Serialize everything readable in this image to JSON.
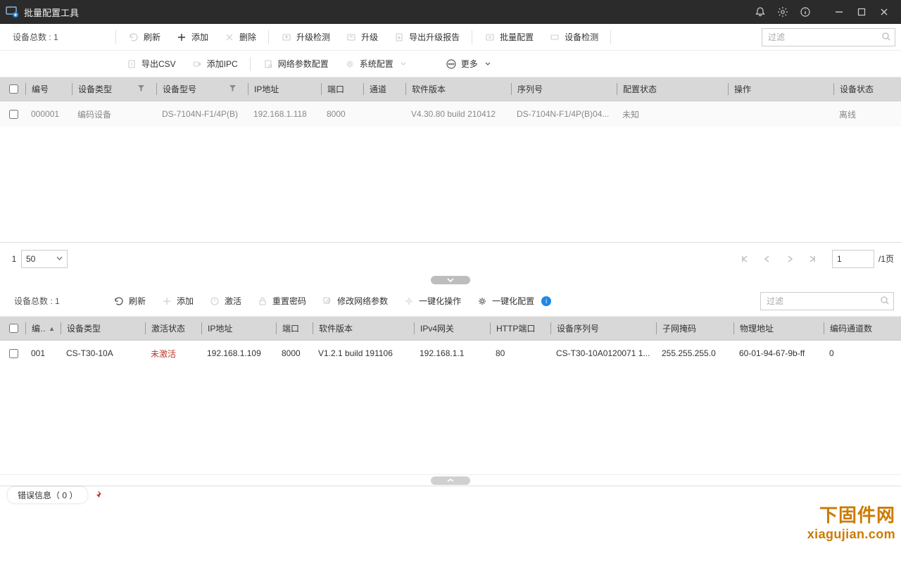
{
  "title": "批量配置工具",
  "top": {
    "device_count_label": "设备总数 : 1",
    "filter_placeholder": "过滤",
    "toolbar1": {
      "refresh": "刷新",
      "add": "添加",
      "delete": "删除",
      "upgrade_check": "升级检测",
      "upgrade": "升级",
      "export_report": "导出升级报告",
      "batch_config": "批量配置",
      "device_check": "设备检测"
    },
    "toolbar2": {
      "export_csv": "导出CSV",
      "add_ipc": "添加IPC",
      "net_param": "网络参数配置",
      "sys_config": "系统配置",
      "more": "更多"
    },
    "columns": [
      "编号",
      "设备类型",
      "设备型号",
      "IP地址",
      "端口",
      "通道",
      "软件版本",
      "序列号",
      "配置状态",
      "操作",
      "设备状态"
    ],
    "row": {
      "no": "000001",
      "type": "编码设备",
      "model": "DS-7104N-F1/4P(B)",
      "ip": "192.168.1.118",
      "port": "8000",
      "channel": "",
      "sw": "V4.30.80 build 210412",
      "serial": "DS-7104N-F1/4P(B)04...",
      "cfg": "未知",
      "op": "",
      "status": "离线"
    },
    "pager": {
      "page": "1",
      "pagesize": "50",
      "goto": "1",
      "total_suffix": "/1页"
    }
  },
  "bottom": {
    "device_count_label": "设备总数 : 1",
    "filter_placeholder": "过滤",
    "toolbar": {
      "refresh": "刷新",
      "add": "添加",
      "activate": "激活",
      "reset_pwd": "重置密码",
      "edit_net": "修改网络参数",
      "one_click_op": "一键化操作",
      "one_click_cfg": "一键化配置"
    },
    "columns": [
      "编号",
      "设备类型",
      "激活状态",
      "IP地址",
      "端口",
      "软件版本",
      "IPv4网关",
      "HTTP端口",
      "设备序列号",
      "子网掩码",
      "物理地址",
      "编码通道数"
    ],
    "row": {
      "no": "001",
      "type": "CS-T30-10A",
      "act": "未激活",
      "ip": "192.168.1.109",
      "port": "8000",
      "sw": "V1.2.1 build 191106",
      "gw": "192.168.1.1",
      "http": "80",
      "serial": "CS-T30-10A0120071 1...",
      "mask": "255.255.255.0",
      "mac": "60-01-94-67-9b-ff",
      "ch": "0"
    }
  },
  "status": {
    "error_info": "错误信息（ 0 ）"
  },
  "watermark": {
    "l1": "下固件网",
    "l2": "xiagujian.com"
  }
}
